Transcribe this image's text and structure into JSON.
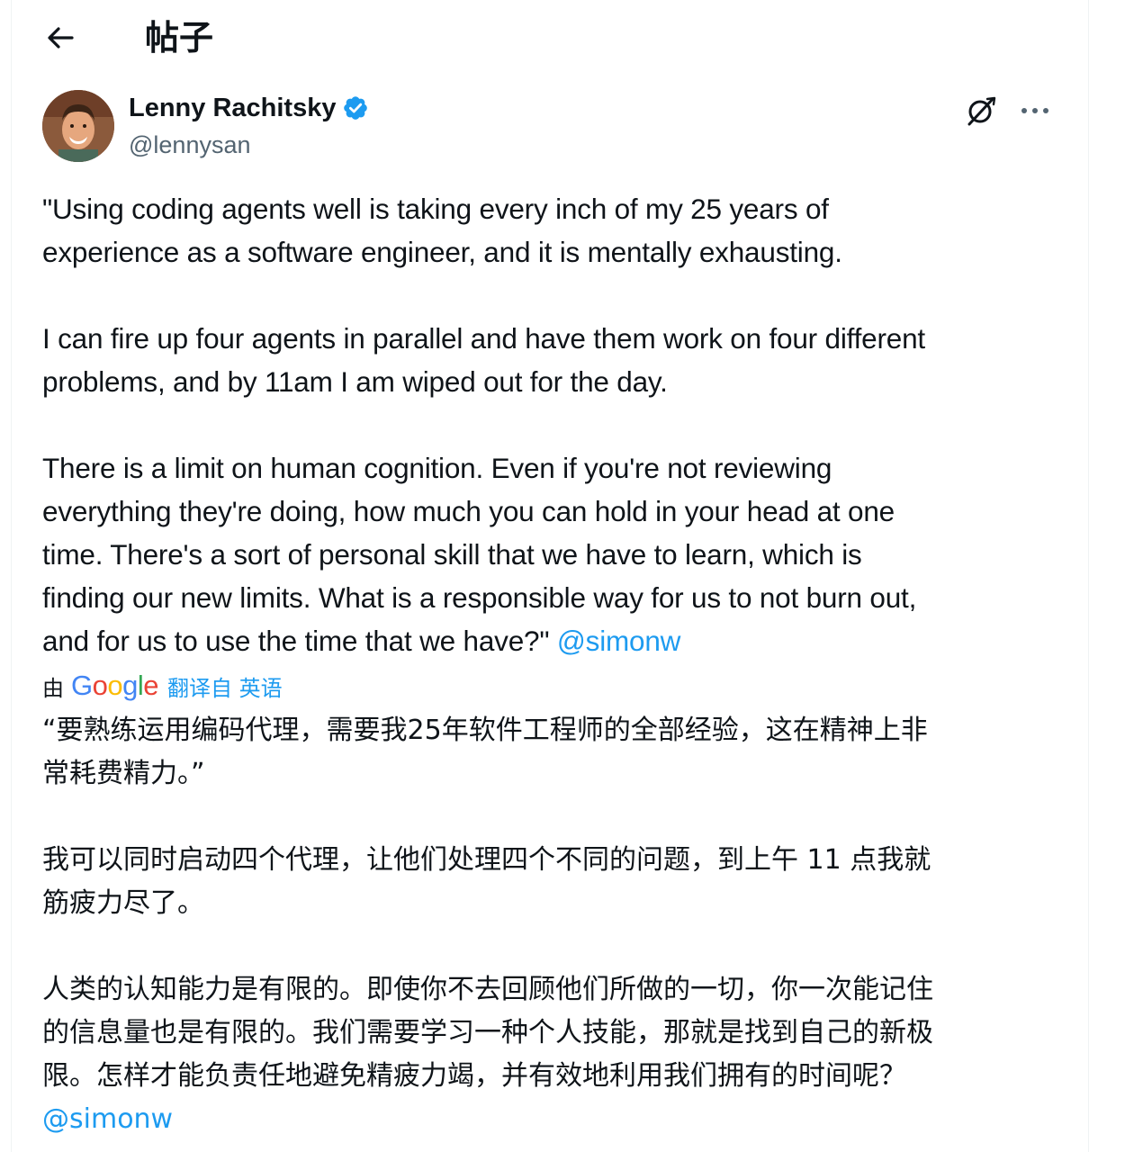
{
  "header": {
    "back_icon": "arrow-left-icon",
    "title": "帖子"
  },
  "author": {
    "name": "Lenny Rachitsky",
    "handle": "@lennysan",
    "verified_icon": "verified-badge-icon",
    "verified_color": "#1d9bf0"
  },
  "actions": {
    "grok_icon": "grok-icon",
    "more_icon": "more-dots-icon"
  },
  "tweet": {
    "text": "\"Using coding agents well is taking every inch of my 25 years of\nexperience as a software engineer, and it is mentally exhausting.\n\nI can fire up four agents in parallel and have them work on four different\nproblems, and by 11am I am wiped out for the day.\n\nThere is a limit on human cognition. Even if you're not reviewing\neverything they're doing, how much you can hold in your head at one\ntime. There's a sort of personal skill that we have to learn, which is\nfinding our new limits. What is a responsible way for us to not burn out,\nand for us to use the time that we have?\" ",
    "mention": "@simonw"
  },
  "translation": {
    "by_label": "由",
    "provider": "Google",
    "link_label": "翻译自 英语",
    "text": "“要熟练运用编码代理，需要我25年软件工程师的全部经验，这在精神上非\n常耗费精力。”\n\n我可以同时启动四个代理，让他们处理四个不同的问题，到上午 11 点我就\n筋疲力尽了。\n\n人类的认知能力是有限的。即使你不去回顾他们所做的一切，你一次能记住\n的信息量也是有限的。我们需要学习一种个人技能，那就是找到自己的新极\n限。怎样才能负责任地避免精疲力竭，并有效地利用我们拥有的时间呢？\n",
    "mention": "@simonw"
  },
  "colors": {
    "link": "#1d9bf0",
    "text": "#0f1419",
    "secondary": "#536471"
  }
}
